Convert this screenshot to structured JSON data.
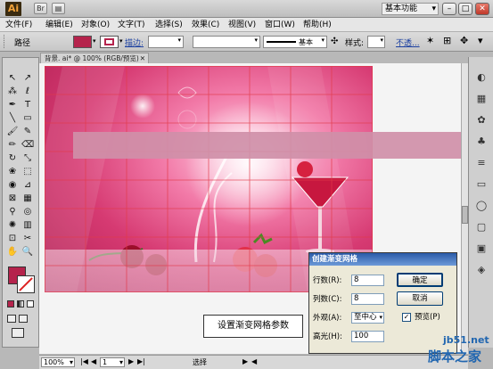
{
  "app": {
    "logo": "Ai",
    "workspace": "基本功能"
  },
  "menu": [
    "文件(F)",
    "编辑(E)",
    "对象(O)",
    "文字(T)",
    "选择(S)",
    "效果(C)",
    "视图(V)",
    "窗口(W)",
    "帮助(H)"
  ],
  "control": {
    "selection_label": "路径",
    "stroke_label": "描边:",
    "brush_label": "基本",
    "style_label": "样式:",
    "opacity_label": "不透...",
    "fill_color": "#b5234c"
  },
  "document": {
    "tab_title": "背景. ai* @ 100% (RGB/预览)"
  },
  "status": {
    "zoom": "100%",
    "page": "1",
    "tool": "选择"
  },
  "dialog": {
    "title": "创建渐变网格",
    "rows_label": "行数(R):",
    "rows_value": "8",
    "cols_label": "列数(C):",
    "cols_value": "8",
    "appearance_label": "外观(A):",
    "appearance_value": "至中心",
    "highlight_label": "高光(H):",
    "highlight_value": "100",
    "ok_label": "确定",
    "cancel_label": "取消",
    "preview_label": "预览(P)"
  },
  "caption": "设置渐变网格参数",
  "watermark": {
    "line1": "jb51.net",
    "line2": "脚本之家"
  }
}
